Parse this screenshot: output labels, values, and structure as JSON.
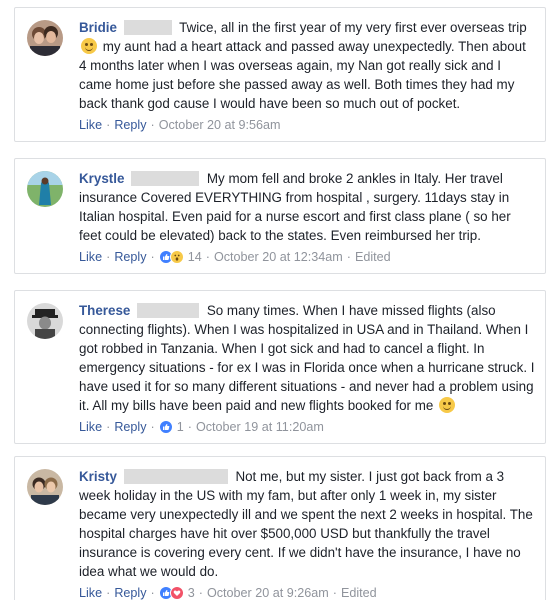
{
  "comments": [
    {
      "author": "Bridie",
      "text": "Twice, all in the first year of my very first ever overseas trip",
      "text2": " my aunt had a heart attack and passed away unexpectedly. Then about 4 months later when I was overseas again, my Nan got really sick and I came home just before she passed away as well. Both times they had my back thank god cause I would have been so much out of pocket.",
      "like": "Like",
      "reply": "Reply",
      "reaction_count": "",
      "timestamp": "October 20 at 9:56am",
      "edited": ""
    },
    {
      "author": "Krystle",
      "text": "My mom fell and broke 2 ankles in Italy. Her travel insurance Covered EVERYTHING from hospital , surgery. 11days stay in Italian hospital. Even paid for a nurse escort and first class plane ( so her feet could be elevated) back to the states. Even reimbursed her trip.",
      "like": "Like",
      "reply": "Reply",
      "reaction_count": "14",
      "timestamp": "October 20 at 12:34am",
      "edited": "Edited"
    },
    {
      "author": "Therese",
      "text": "So many times. When I have missed flights (also connecting flights). When I was hospitalized in USA and in Thailand. When I got robbed in Tanzania. When I got sick and had to cancel a flight. In emergency situations - for ex I was in Florida once when a hurricane struck. I have used it for so many different situations - and never had a problem using it. All my bills have been paid and new flights booked for me",
      "like": "Like",
      "reply": "Reply",
      "reaction_count": "1",
      "timestamp": "October 19 at 11:20am",
      "edited": ""
    },
    {
      "author": "Kristy",
      "text": "Not me, but my sister. I just got back from a 3 week holiday in the US with my fam, but after only 1 week in, my sister became very unexpectedly ill and we spent the next 2 weeks in hospital. The hospital charges have hit over $500,000 USD but thankfully the travel insurance is covering every cent. If we didn't have the insurance, I have no idea what we would do.",
      "like": "Like",
      "reply": "Reply",
      "reaction_count": "3",
      "timestamp": "October 20 at 9:26am",
      "edited": "Edited"
    }
  ],
  "colors": {
    "link": "#365899",
    "meta": "#90949c",
    "text": "#1d2129",
    "border": "#dddfe2",
    "like_reaction": "#4080ff",
    "love_reaction": "#f25268",
    "wow_reaction": "#f7c948"
  },
  "icons": {
    "emoji": "smiling-face-emoji",
    "like": "thumbs-up-reaction-icon",
    "love": "heart-reaction-icon",
    "wow": "wow-reaction-icon"
  }
}
